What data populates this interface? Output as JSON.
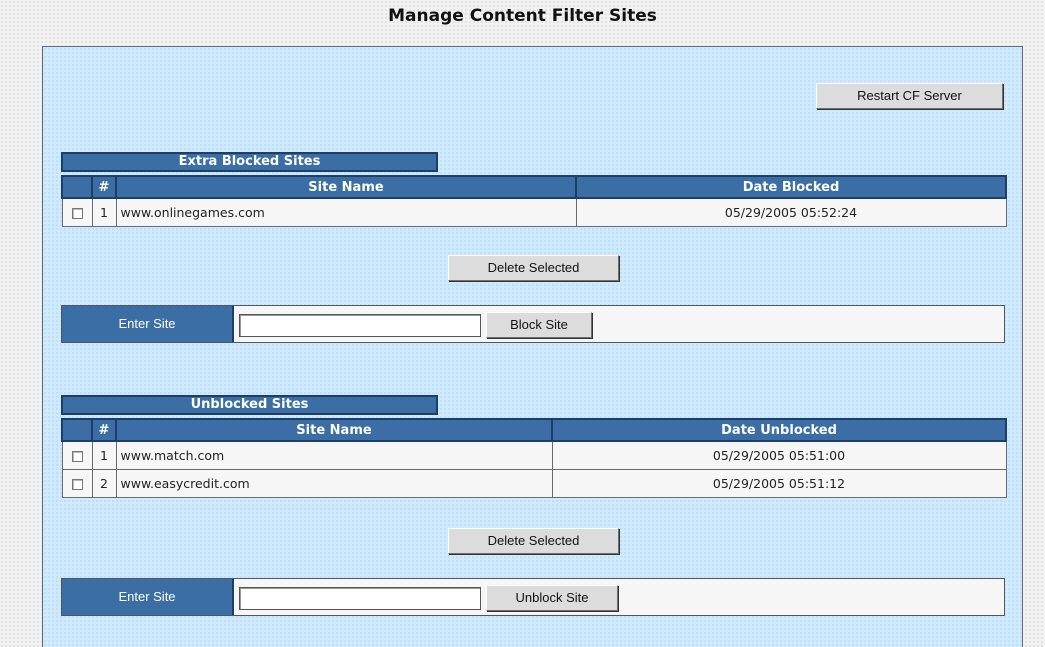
{
  "page": {
    "title": "Manage Content Filter Sites"
  },
  "toolbar": {
    "restart_label": "Restart CF Server"
  },
  "blocked": {
    "heading": "Extra Blocked Sites",
    "columns": {
      "num": "#",
      "site": "Site Name",
      "date": "Date Blocked"
    },
    "rows": [
      {
        "num": "1",
        "site": "www.onlinegames.com",
        "date": "05/29/2005 05:52:24",
        "checked": false
      }
    ],
    "delete_label": "Delete Selected",
    "entry_label": "Enter Site",
    "entry_value": "",
    "submit_label": "Block Site"
  },
  "unblocked": {
    "heading": "Unblocked Sites",
    "columns": {
      "num": "#",
      "site": "Site Name",
      "date": "Date Unblocked"
    },
    "rows": [
      {
        "num": "1",
        "site": "www.match.com",
        "date": "05/29/2005 05:51:00",
        "checked": false
      },
      {
        "num": "2",
        "site": "www.easycredit.com",
        "date": "05/29/2005 05:51:12",
        "checked": false
      }
    ],
    "delete_label": "Delete Selected",
    "entry_label": "Enter Site",
    "entry_value": "",
    "submit_label": "Unblock Site"
  },
  "colors": {
    "header_blue": "#3a6ea5",
    "panel_bg": "#cfe9ff",
    "button_bg": "#dcdcdc"
  }
}
